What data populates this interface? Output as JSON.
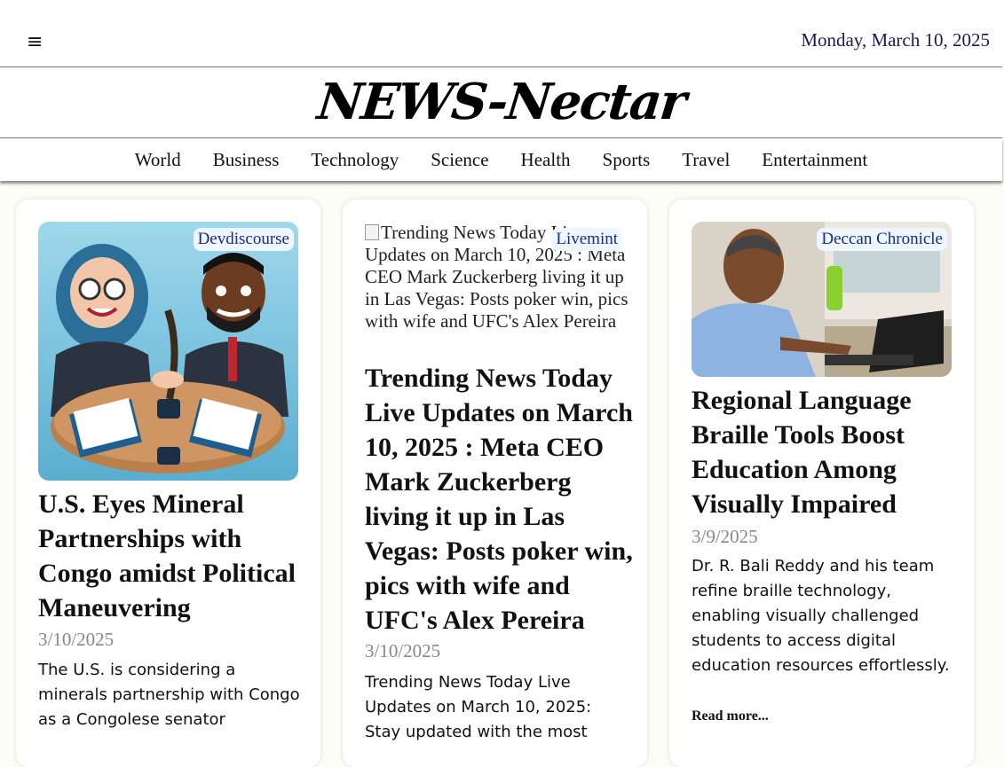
{
  "header": {
    "menu_icon": "≡",
    "date": "Monday, March 10, 2025",
    "logo": "NEWS-Nectar"
  },
  "nav": {
    "items": [
      "World",
      "Business",
      "Technology",
      "Science",
      "Health",
      "Sports",
      "Travel",
      "Entertainment"
    ]
  },
  "articles": [
    {
      "source": "Devdiscourse",
      "image_icon": "handshake-cartoon-image",
      "title": "U.S. Eyes Mineral Partnerships with Congo amidst Political Maneuvering",
      "date": "3/10/2025",
      "summary": "The U.S. is considering a minerals partnership with Congo as a Congolese senator"
    },
    {
      "source": "Livemint",
      "image_alt": "Trending News Today Live Updates on March 10, 2025 : Meta CEO Mark Zuckerberg living it up in Las Vegas: Posts poker win, pics with wife and UFC's Alex Pereira",
      "title": "Trending News Today Live Updates on March 10, 2025 : Meta CEO Mark Zuckerberg living it up in Las Vegas: Posts poker win, pics with wife and UFC's Alex Pereira",
      "date": "3/10/2025",
      "summary": "Trending News Today Live Updates on March 10, 2025: Stay updated with the most"
    },
    {
      "source": "Deccan Chronicle",
      "image_icon": "man-at-laptop-photo",
      "title": "Regional Language Braille Tools Boost Education Among Visually Impaired",
      "date": "3/9/2025",
      "summary": "Dr. R. Bali Reddy and his team refine braille technology, enabling visually challenged students to access digital education resources effortlessly.",
      "read_more": "Read more..."
    }
  ]
}
